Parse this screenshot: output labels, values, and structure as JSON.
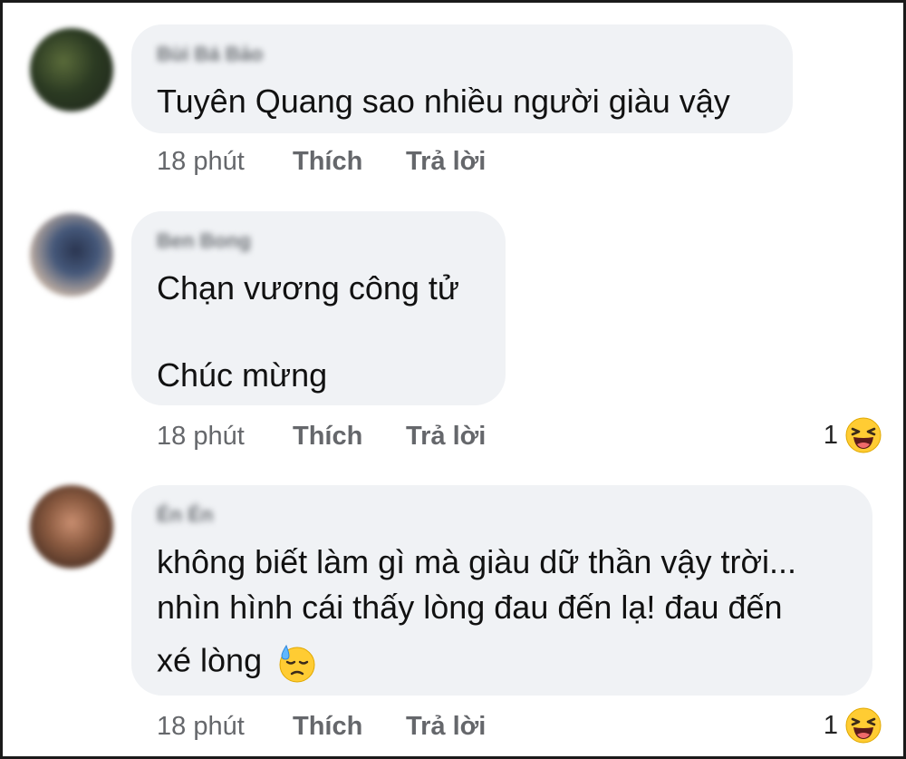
{
  "comments": [
    {
      "author": "Bùi Bá Bảo",
      "lines": [
        "Tuyên Quang sao nhiều người giàu vậy"
      ],
      "time": "18 phút",
      "like_label": "Thích",
      "reply_label": "Trả lời"
    },
    {
      "author": "Ben Bong",
      "lines": [
        "Chạn vương công tử",
        "Chúc mừng"
      ],
      "time": "18 phút",
      "like_label": "Thích",
      "reply_label": "Trả lời",
      "reaction_count": "1",
      "reaction_icon": "laughing-emoji"
    },
    {
      "author": "Én Én",
      "lines": [
        "không biết làm gì mà giàu dữ thần vậy trời...",
        "nhìn hình cái thấy lòng đau đến lạ! đau đến",
        "xé lòng"
      ],
      "inline_emoji": "downcast-sweat-emoji",
      "time": "18 phút",
      "like_label": "Thích",
      "reply_label": "Trả lời",
      "reaction_count": "1",
      "reaction_icon": "laughing-emoji"
    }
  ],
  "colors": {
    "bubble": "#f0f2f5",
    "meta_text": "#65676b",
    "body_text": "#111111",
    "emoji_yellow": "#ffcc33"
  }
}
